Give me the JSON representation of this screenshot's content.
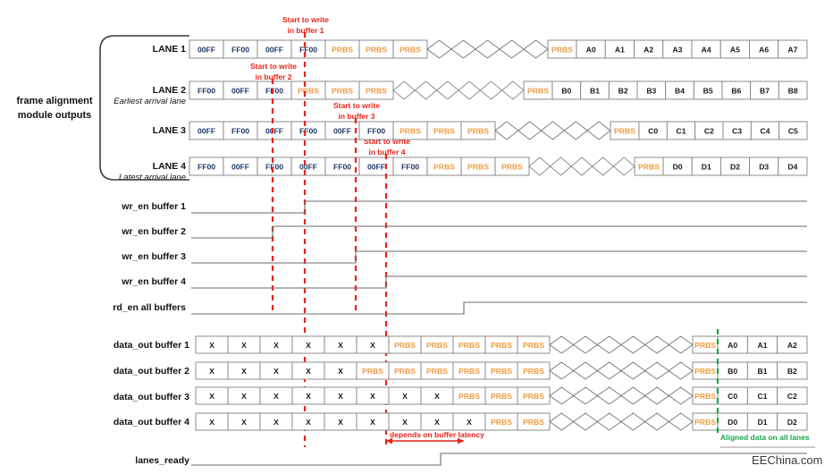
{
  "group_label": {
    "line1": "frame alignment",
    "line2": "module outputs"
  },
  "watermark": "EEChina.com",
  "colors": {
    "hex": "#1f3864",
    "prbs": "#ed9b40",
    "data": "#1a1a1a",
    "red": "#e8221b",
    "green": "#1aa64a",
    "wave": "#6b6b6b",
    "border": "#808080"
  },
  "lanes": [
    {
      "name": "LANE 1",
      "sub": "",
      "cells_left": [
        "00FF",
        "FF00",
        "00FF",
        "FF00",
        "PRBS",
        "PRBS",
        "PRBS"
      ],
      "cells_right": [
        "PRBS",
        "A0",
        "A1",
        "A2",
        "A3",
        "A4",
        "A5",
        "A6",
        "A7"
      ]
    },
    {
      "name": "LANE 2",
      "sub": "Earliest arrival lane",
      "cells_left": [
        "FF00",
        "00FF",
        "FF00",
        "PRBS",
        "PRBS",
        "PRBS"
      ],
      "cells_right": [
        "PRBS",
        "B0",
        "B1",
        "B2",
        "B3",
        "B4",
        "B5",
        "B6",
        "B7",
        "B8"
      ]
    },
    {
      "name": "LANE 3",
      "sub": "",
      "cells_left": [
        "00FF",
        "FF00",
        "00FF",
        "FF00",
        "00FF",
        "FF00",
        "PRBS",
        "PRBS",
        "PRBS"
      ],
      "cells_right": [
        "PRBS",
        "C0",
        "C1",
        "C2",
        "C3",
        "C4",
        "C5"
      ]
    },
    {
      "name": "LANE 4",
      "sub": "Latest arrival lane",
      "cells_left": [
        "FF00",
        "00FF",
        "FF00",
        "00FF",
        "FF00",
        "00FF",
        "FF00",
        "PRBS",
        "PRBS",
        "PRBS"
      ],
      "cells_right": [
        "PRBS",
        "D0",
        "D1",
        "D2",
        "D3",
        "D4"
      ]
    }
  ],
  "annotations": [
    {
      "line1": "Start to write",
      "line2": "in buffer 1"
    },
    {
      "line1": "Start to write",
      "line2": "in buffer 2"
    },
    {
      "line1": "Start to write",
      "line2": "in buffer 3"
    },
    {
      "line1": "Start to write",
      "line2": "in buffer 4"
    }
  ],
  "signals": [
    {
      "label": "wr_en buffer 1"
    },
    {
      "label": "wr_en buffer 2"
    },
    {
      "label": "wr_en buffer 3"
    },
    {
      "label": "wr_en buffer 4"
    },
    {
      "label": "rd_en  all buffers"
    }
  ],
  "data_out": [
    {
      "label": "data_out buffer 1",
      "cells_left": [
        "X",
        "X",
        "X",
        "X",
        "X",
        "X",
        "PRBS",
        "PRBS",
        "PRBS",
        "PRBS",
        "PRBS"
      ],
      "cells_right": [
        "PRBS",
        "A0",
        "A1",
        "A2"
      ]
    },
    {
      "label": "data_out buffer 2",
      "cells_left": [
        "X",
        "X",
        "X",
        "X",
        "X",
        "PRBS",
        "PRBS",
        "PRBS",
        "PRBS",
        "PRBS",
        "PRBS"
      ],
      "cells_right": [
        "PRBS",
        "B0",
        "B1",
        "B2"
      ]
    },
    {
      "label": "data_out buffer 3",
      "cells_left": [
        "X",
        "X",
        "X",
        "X",
        "X",
        "X",
        "X",
        "X",
        "PRBS",
        "PRBS",
        "PRBS"
      ],
      "cells_right": [
        "PRBS",
        "C0",
        "C1",
        "C2"
      ]
    },
    {
      "label": "data_out buffer 4",
      "cells_left": [
        "X",
        "X",
        "X",
        "X",
        "X",
        "X",
        "X",
        "X",
        "X",
        "PRBS",
        "PRBS"
      ],
      "cells_right": [
        "PRBS",
        "D0",
        "D1",
        "D2"
      ]
    }
  ],
  "latency_note": "depends on buffer latency",
  "aligned_note": "Aligned data on all lanes",
  "ready_signal": {
    "label": "lanes_ready"
  }
}
